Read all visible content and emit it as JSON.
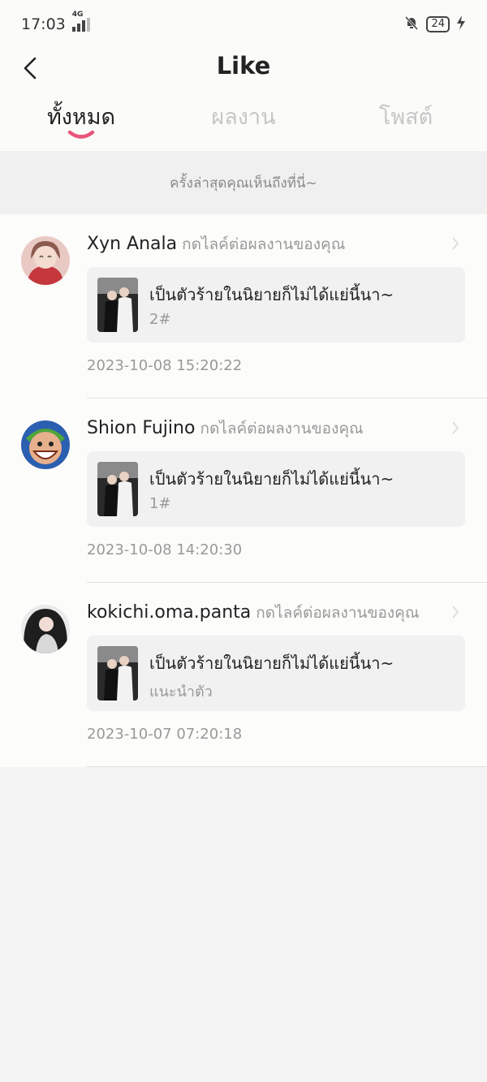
{
  "status_bar": {
    "time": "17:03",
    "network": "4G",
    "battery": "24"
  },
  "header": {
    "title": "Like"
  },
  "tabs": [
    {
      "label": "ทั้งหมด",
      "active": true
    },
    {
      "label": "ผลงาน",
      "active": false
    },
    {
      "label": "โพสต์",
      "active": false
    }
  ],
  "notice": "ครั้งล่าสุดคุณเห็นถึงที่นี่~",
  "items": [
    {
      "user": "Xyn Anala",
      "action": "กดไลค์ต่อผลงานของคุณ",
      "work_title": "เป็นตัวร้ายในนิยายก็ไม่ได้แย่นี้นา~",
      "work_sub": "2#",
      "time": "2023-10-08 15:20:22"
    },
    {
      "user": "Shion Fujino",
      "action": "กดไลค์ต่อผลงานของคุณ",
      "work_title": "เป็นตัวร้ายในนิยายก็ไม่ได้แย่นี้นา~",
      "work_sub": "1#",
      "time": "2023-10-08 14:20:30"
    },
    {
      "user": "kokichi.oma.panta",
      "action": "กดไลค์ต่อผลงานของคุณ",
      "work_title": "เป็นตัวร้ายในนิยายก็ไม่ได้แย่นี้นา~",
      "work_sub": "แนะนำตัว",
      "time": "2023-10-07 07:20:18"
    }
  ],
  "colors": {
    "accent": "#e8557a",
    "background": "#f3f3f3"
  }
}
